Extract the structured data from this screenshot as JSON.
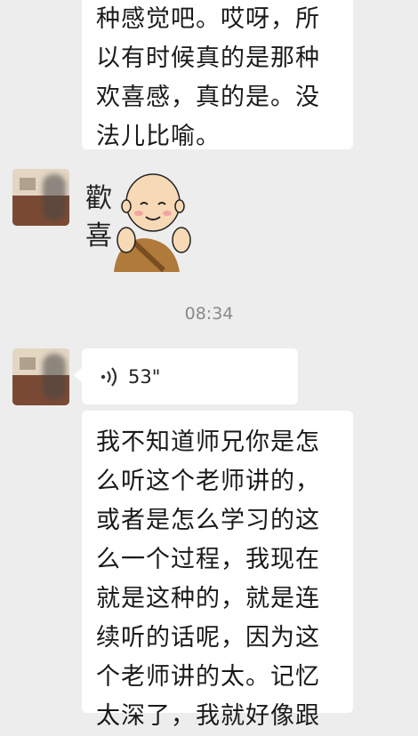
{
  "messages": {
    "m1": {
      "text": "种感觉吧。哎呀，所\n以有时候真的是那种\n欢喜感，真的是。没\n法儿比喻。"
    },
    "sticker": {
      "chars": [
        "歡",
        "喜"
      ]
    },
    "timestamp": "08:34",
    "voice": {
      "icon": "voice-wave-icon",
      "duration": "53\""
    },
    "m2": {
      "text": "我不知道师兄你是怎\n么听这个老师讲的，\n或者是怎么学习的这\n么一个过程，我现在\n就是这种的，就是连\n续听的话呢，因为这\n个老师讲的太。记忆\n太深了，我就好像跟"
    }
  },
  "colors": {
    "background": "#ededed",
    "bubble": "#ffffff",
    "robe": "#b07a3a"
  }
}
